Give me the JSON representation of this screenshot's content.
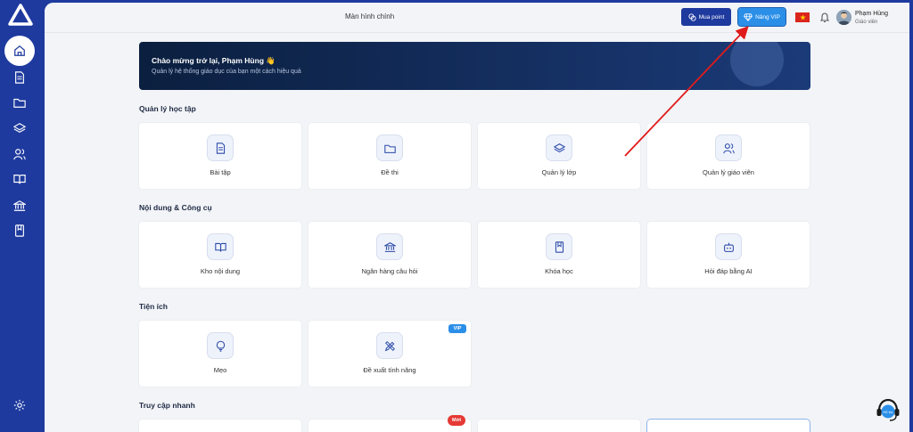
{
  "topbar": {
    "title": "Màn hình chính",
    "buy_point_label": "Mua point",
    "upgrade_vip_label": "Nâng VIP"
  },
  "user": {
    "name": "Phạm Hùng",
    "role": "Giáo viên"
  },
  "banner": {
    "title": "Chào mừng trở lại, Phạm Hùng 👋",
    "subtitle": "Quản lý hệ thống giáo dục của bạn một cách hiệu quả"
  },
  "sections": {
    "learning": {
      "title": "Quản lý học tập",
      "cards": [
        {
          "label": "Bài tập",
          "icon": "document-icon"
        },
        {
          "label": "Đề thi",
          "icon": "folder-icon"
        },
        {
          "label": "Quản lý lớp",
          "icon": "layers-icon"
        },
        {
          "label": "Quản lý giáo viên",
          "icon": "users-icon"
        }
      ]
    },
    "content": {
      "title": "Nội dung & Công cụ",
      "cards": [
        {
          "label": "Kho nội dung",
          "icon": "book-open-icon"
        },
        {
          "label": "Ngân hàng câu hỏi",
          "icon": "bank-icon"
        },
        {
          "label": "Khóa học",
          "icon": "book-icon"
        },
        {
          "label": "Hỏi đáp bằng AI",
          "icon": "bot-icon"
        }
      ]
    },
    "utilities": {
      "title": "Tiện ích",
      "cards": [
        {
          "label": "Mẹo",
          "icon": "lightbulb-icon"
        },
        {
          "label": "Đề xuất tính năng",
          "icon": "pencil-ruler-icon",
          "badge": "VIP"
        }
      ]
    },
    "quick_access": {
      "title": "Truy cập nhanh",
      "new_badge": "Mới"
    }
  },
  "support_label": "Hỗ trợ",
  "colors": {
    "sidebar": "#1e3a9e",
    "accent": "#2b8fe8",
    "annotation_arrow": "#e01b1b"
  }
}
